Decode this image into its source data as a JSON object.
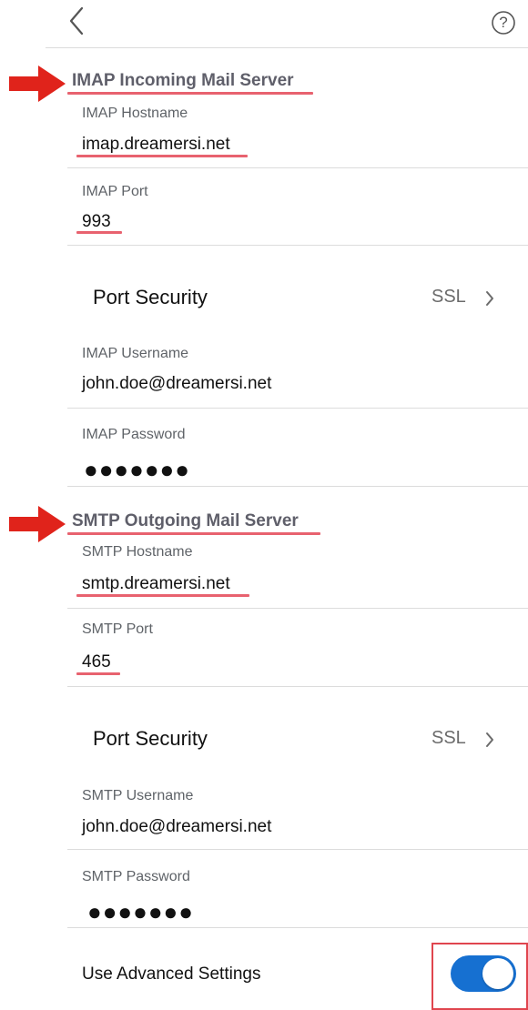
{
  "header": {
    "back_icon": "chevron-left-icon",
    "help_icon": "question-circle-icon",
    "help_glyph": "?"
  },
  "imap": {
    "section_title": "IMAP Incoming Mail Server",
    "hostname_label": "IMAP Hostname",
    "hostname_value": "imap.dreamersi.net",
    "port_label": "IMAP Port",
    "port_value": "993",
    "security_label": "Port Security",
    "security_value": "SSL",
    "username_label": "IMAP Username",
    "username_value": "john.doe@dreamersi.net",
    "password_label": "IMAP Password",
    "password_value": "●●●●●●●"
  },
  "smtp": {
    "section_title": "SMTP Outgoing Mail Server",
    "hostname_label": "SMTP Hostname",
    "hostname_value": "smtp.dreamersi.net",
    "port_label": "SMTP Port",
    "port_value": "465",
    "security_label": "Port Security",
    "security_value": "SSL",
    "username_label": "SMTP Username",
    "username_value": "john.doe@dreamersi.net",
    "password_label": "SMTP Password",
    "password_value": "●●●●●●●"
  },
  "advanced": {
    "label": "Use Advanced Settings",
    "enabled": true
  },
  "colors": {
    "annotation_red": "#e0231b",
    "underline": "#e8626f",
    "toggle_on": "#1670d1"
  }
}
